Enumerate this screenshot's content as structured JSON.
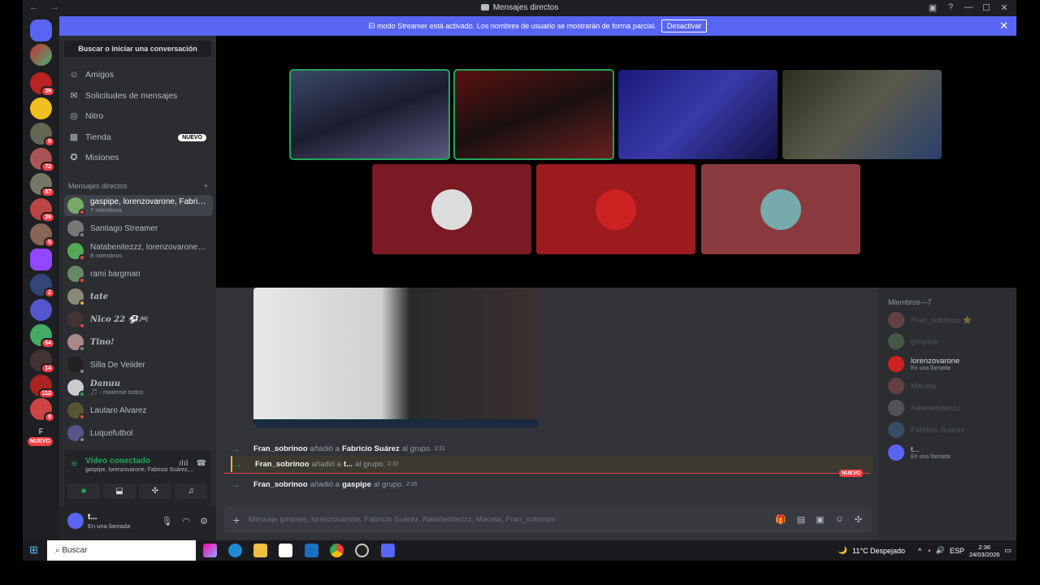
{
  "window": {
    "title": "Mensajes directos",
    "nav": "← →"
  },
  "banner": {
    "text": "El modo Streamer está activado. Los nombres de usuario se mostrarán de forma parcial.",
    "button": "Desactivar"
  },
  "sidebar": {
    "search": "Buscar o iniciar una conversación",
    "nav": [
      {
        "label": "Amigos",
        "icon": "friends-icon"
      },
      {
        "label": "Solicitudes de mensajes",
        "icon": "mail-icon"
      },
      {
        "label": "Nitro",
        "icon": "nitro-icon"
      },
      {
        "label": "Tienda",
        "icon": "shop-icon",
        "tag": "NUEVO"
      },
      {
        "label": "Misiones",
        "icon": "quest-icon"
      }
    ],
    "dm_header": "Mensajes directos",
    "dm_add": "+",
    "dms": [
      {
        "name": "gaspipe, lorenzovarone, Fabricio Suárez",
        "sub": "7 miembros"
      },
      {
        "name": "Santiago Streamer",
        "sub": ""
      },
      {
        "name": "Natabenitezzz, lorenzovarone, …",
        "sub": "8 miembros"
      },
      {
        "name": "rami bargman",
        "sub": ""
      },
      {
        "name": "tate",
        "sub": ""
      },
      {
        "name": "Nico 22 ⚽🎮",
        "sub": ""
      },
      {
        "name": "Tino!",
        "sub": ""
      },
      {
        "name": "Silla De Veiider",
        "sub": ""
      },
      {
        "name": "Danuu",
        "sub": "🎵 - matense todos"
      },
      {
        "name": "Lautaro Alvarez",
        "sub": ""
      },
      {
        "name": "Luquefutbol",
        "sub": ""
      }
    ]
  },
  "guilds": {
    "badges": [
      "39",
      "9",
      "72",
      "87",
      "29",
      "5",
      "2",
      "64",
      "14",
      "112",
      "8"
    ],
    "letter": "F",
    "new_tag": "NUEVO"
  },
  "voice": {
    "title": "Vídeo conectado",
    "subtitle": "gaspipe, lorenzovarone, Fabricio Suárez,..."
  },
  "user": {
    "name": "t...",
    "status": "En una llamada"
  },
  "chat": {
    "messages": [
      {
        "user": "Fran_sobrinoo",
        "action": "añadió a",
        "target": "Fabricio Suárez",
        "suffix": "al grupo.",
        "time": "2:31"
      },
      {
        "user": "Fran_sobrinoo",
        "action": "añadió a",
        "target": "t...",
        "suffix": "al grupo.",
        "time": "2:32"
      },
      {
        "user": "Fran_sobrinoo",
        "action": "añadió a",
        "target": "gaspipe",
        "suffix": "al grupo.",
        "time": "2:35"
      }
    ],
    "new_tag": "NUEVO",
    "composer_placeholder": "Mensaje gaspipe, lorenzovarone, Fabricio Suárez, Natabenitezzz, Maceta, Fran_sobrinoo"
  },
  "members": {
    "header": "Miembros—7",
    "list": [
      {
        "name": "Fran_sobrinoo ⭐",
        "status": "",
        "active": false
      },
      {
        "name": "gaspipe",
        "status": "",
        "active": false
      },
      {
        "name": "lorenzovarone",
        "status": "En una llamada",
        "active": true
      },
      {
        "name": "Maceta",
        "status": "",
        "active": false
      },
      {
        "name": "Natabenitezzz",
        "status": "",
        "active": false
      },
      {
        "name": "Fabricio Suárez",
        "status": "",
        "active": false
      },
      {
        "name": "t...",
        "status": "En una llamada",
        "active": true
      }
    ]
  },
  "taskbar": {
    "search": "Buscar",
    "weather": "11°C Despejado",
    "lang": "ESP",
    "time": "2:36",
    "date": "24/03/2026"
  },
  "colors": {
    "accent": "#5865f2",
    "online": "#23a55a",
    "danger": "#f23f43"
  }
}
